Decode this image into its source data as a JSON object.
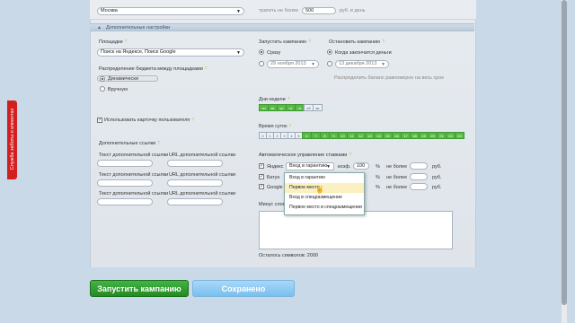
{
  "top": {
    "city": "Москва",
    "limit_prefix": "тратить не более",
    "limit_value": "500",
    "limit_suffix": "руб. в день"
  },
  "extra_settings": {
    "label": "Дополнительные настройки"
  },
  "left": {
    "platforms_label": "Площадки",
    "platforms_value": "Поиск на Яндексе, Поиск Google",
    "budget_label": "Распределение бюджета между площадками",
    "budget_options": [
      "Динамически",
      "Вручную"
    ],
    "user_card_label": "Использовать карточку пользователя",
    "extra_links_label": "Дополнительные ссылки",
    "link_text_label": "Текст дополнительной ссылки",
    "link_url_label": "URL дополнительной ссылки"
  },
  "start": {
    "label": "Запустить кампанию",
    "option_now": "Сразу",
    "date_value": "29 ноября 2013"
  },
  "stop": {
    "label": "Остановить кампанию",
    "option_money": "Когда закончатся деньги",
    "date_value": "13 декабря 2013",
    "spread_label": "Распределить баланс равномерно на весь срок"
  },
  "days": {
    "label": "Дни недели",
    "items": [
      "пн",
      "вт",
      "ср",
      "чт",
      "пт",
      "сб",
      "вс"
    ]
  },
  "hours": {
    "label": "Время суток",
    "items": [
      "0",
      "1",
      "2",
      "3",
      "4",
      "5",
      "6",
      "7",
      "8",
      "9",
      "10",
      "11",
      "12",
      "13",
      "14",
      "15",
      "16",
      "17",
      "18",
      "19",
      "20",
      "21",
      "22",
      "23"
    ]
  },
  "auto": {
    "label": "Автоматическое управление ставками",
    "rows": [
      {
        "name": "Яндекс",
        "strategy": "Вход в гарантию",
        "coef_label": "коэф.",
        "coef": "100",
        "pct": "%",
        "max_label": "не более",
        "currency": "руб."
      },
      {
        "name": "Бегун",
        "pct": "%",
        "max_label": "не более",
        "currency": "руб."
      },
      {
        "name": "Google",
        "pct": "%",
        "max_label": "не более",
        "currency": "руб."
      }
    ],
    "dropdown": [
      "Вход в гарантию",
      "Первое место",
      "Вход в спецразмещение",
      "Первое место в спецразмещении"
    ]
  },
  "minus": {
    "label": "Минус слов",
    "remaining": "Осталось символов: 2000"
  },
  "side_tab": "Служба заботы о клиентах",
  "buttons": {
    "launch": "Запустить кампанию",
    "saved": "Сохранено"
  }
}
